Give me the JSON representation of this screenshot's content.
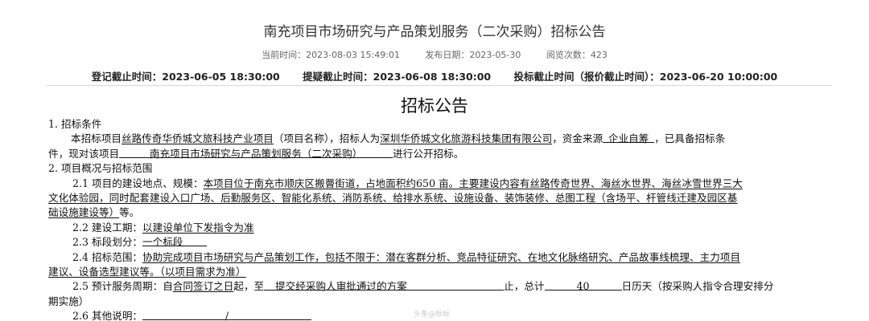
{
  "header": {
    "title": "南充项目市场研究与产品策划服务（二次采购）招标公告",
    "meta": {
      "current_time_label": "当前时间：",
      "current_time": "2023-08-03 15:49:01",
      "publish_date_label": "发布日期：",
      "publish_date": "2023-05-30",
      "views_label": "阅览次数：",
      "views": "423"
    },
    "deadlines": {
      "register_label": "登记截止时间：",
      "register": "2023-06-05 18:30:00",
      "question_label": "提疑截止时间：",
      "question": "2023-06-08 18:30:00",
      "bid_label": "投标截止时间（报价截止时间）：",
      "bid": "2023-06-20 10:00:00"
    }
  },
  "doc": {
    "title": "招标公告",
    "s1": {
      "heading": "1. 招标条件",
      "p_a": "本招标项目",
      "project_name": "丝路传奇华侨城文旅科技产业项目",
      "p_b": "（项目名称），招标人为",
      "tenderer": "深圳华侨城文化旅游科技集团有限公司",
      "p_c": "，资金来源",
      "fund": "企业自筹",
      "p_d": "，已具备招标条",
      "p_e": "件，现对该项目",
      "project_title": "南充项目市场研究与产品策划服务（二次采购）",
      "p_f": "进行公开招标。"
    },
    "s2": {
      "heading": "2. 项目概况与招标范围",
      "i21_label": "2.1 项目的建设地点、规模：",
      "i21_l1": "本项目位于南充市顺庆区搬罾街道，占地面积约650 亩。主要建设内容有丝路传奇世界、海丝水世界、海丝冰雪世界三大",
      "i21_l2": "文化体验园，同时配套建设入口广场、后勤服务区、智能化系统、消防系统、给排水系统、设施设备、装饰装修、总图工程（含场平、杆管线迁建及园区基",
      "i21_l3": "础设施建设等）",
      "i21_end": "等。",
      "i22_label": "2.2 建设工期：",
      "i22_value": "以建设单位下发指令为准",
      "i23_label": "2.3 标段划分：",
      "i23_value": "一个标段",
      "i24_label": "2.4 招标范围：",
      "i24_l1": "协助完成项目市场研究与产品策划工作，包括不限于：潜在客群分析、竞品特征研究、在地文化脉络研究、产品故事线梳理、主力项目",
      "i24_l2": "建议、设备选型建议等。（以项目需求为准）",
      "i25_label": "2.5 预计服务周期：自",
      "i25_from": "合同签订之日",
      "i25_b": "起，至",
      "i25_to": "提交经采购人审批通过的方案",
      "i25_c": "止，总计",
      "i25_days": "40",
      "i25_d": "日历天（按采购人指令合理安排分",
      "i25_l2": "期实施）",
      "i26_label": "2.6 其他说明：",
      "i26_value": "/"
    }
  },
  "watermark": "头条@标标"
}
